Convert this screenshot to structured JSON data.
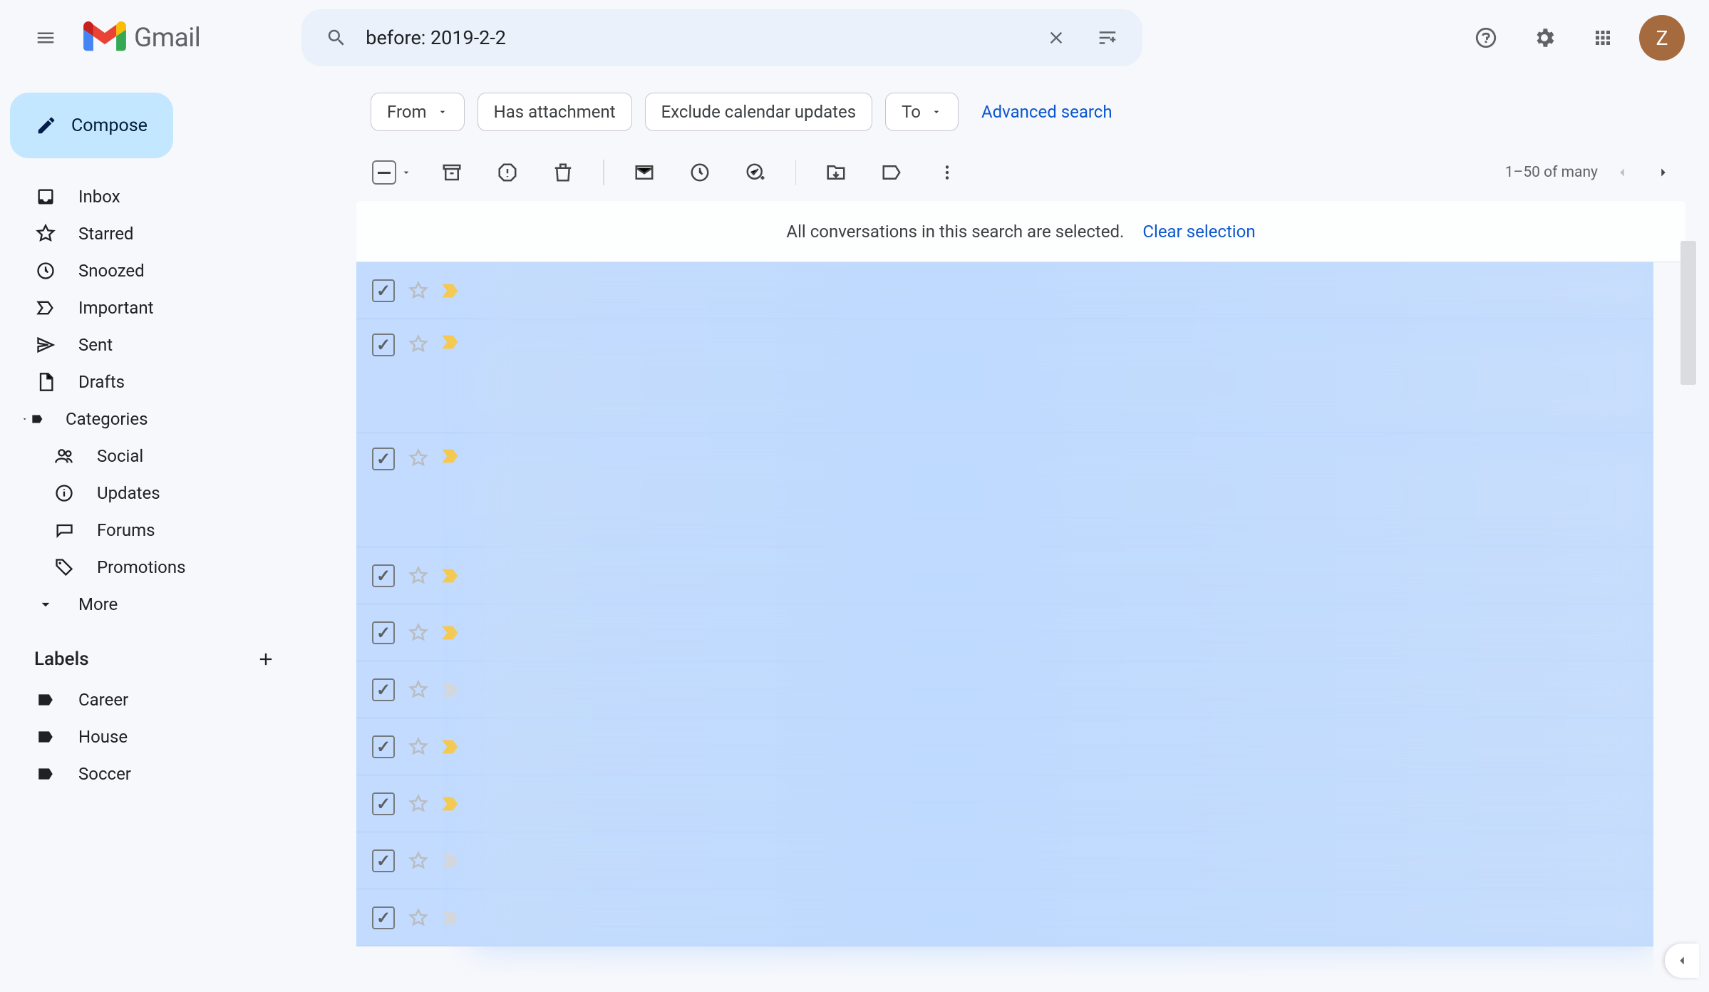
{
  "header": {
    "brand": "Gmail",
    "avatar_letter": "Z"
  },
  "search": {
    "value": "before: 2019-2-2"
  },
  "compose_label": "Compose",
  "nav": {
    "inbox": "Inbox",
    "starred": "Starred",
    "snoozed": "Snoozed",
    "important": "Important",
    "sent": "Sent",
    "drafts": "Drafts",
    "categories": "Categories",
    "social": "Social",
    "updates": "Updates",
    "forums": "Forums",
    "promotions": "Promotions",
    "more": "More"
  },
  "labels": {
    "title": "Labels",
    "items": [
      "Career",
      "House",
      "Soccer"
    ]
  },
  "filters": {
    "from": "From",
    "has_attachment": "Has attachment",
    "exclude_calendar": "Exclude calendar updates",
    "to": "To",
    "advanced": "Advanced search"
  },
  "selection_banner": {
    "text": "All conversations in this search are selected.",
    "clear": "Clear selection"
  },
  "pagination": {
    "text": "1–50 of many"
  },
  "rows": [
    {
      "checked": true,
      "imp": "y",
      "tall": false
    },
    {
      "checked": true,
      "imp": "y",
      "tall": true
    },
    {
      "checked": true,
      "imp": "y",
      "tall": true
    },
    {
      "checked": true,
      "imp": "y",
      "tall": false
    },
    {
      "checked": true,
      "imp": "y",
      "tall": false
    },
    {
      "checked": true,
      "imp": "g",
      "tall": false
    },
    {
      "checked": true,
      "imp": "y",
      "tall": false
    },
    {
      "checked": true,
      "imp": "y",
      "tall": false
    },
    {
      "checked": true,
      "imp": "g",
      "tall": false
    },
    {
      "checked": true,
      "imp": "g",
      "tall": false
    }
  ]
}
